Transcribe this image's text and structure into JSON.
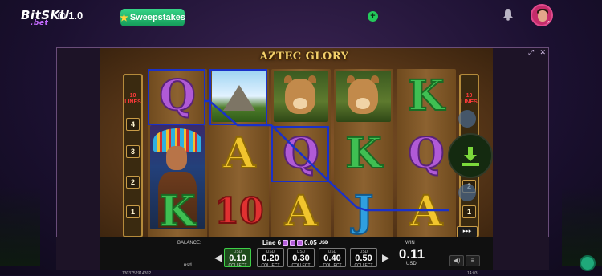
{
  "site": {
    "logo_main": "BitSKU",
    "logo_sub": ".bet",
    "version": "® 1.0",
    "sweep_label": "Sweepstakes",
    "add_label": "+",
    "avatar_chevron": "▾"
  },
  "game": {
    "title": "AZTEC GLORY",
    "lines_left": "10",
    "lines_right": "10",
    "lines_word": "LINES",
    "left_numbers": [
      "4",
      "3",
      "2",
      "1"
    ],
    "right_numbers": [
      "2",
      "1"
    ],
    "auto_label": "▸▸▸",
    "reels": [
      [
        "Q",
        "chief",
        "K"
      ],
      [
        "pyramid",
        "A",
        "10"
      ],
      [
        "puma",
        "Q",
        "A"
      ],
      [
        "puma",
        "K",
        "J"
      ],
      [
        "K",
        "Q",
        "A"
      ]
    ]
  },
  "controls": {
    "balance_label": "BALANCE:",
    "balance_unit": "usd",
    "line_label": "Line 6",
    "line_value": "0.05",
    "line_unit": "USD",
    "win_label": "WIN",
    "win_value": "0.11",
    "win_unit": "USD",
    "bets": [
      {
        "unit": "USD",
        "value": "0.10",
        "action": "COLLECT",
        "selected": true
      },
      {
        "unit": "USD",
        "value": "0.20",
        "action": "COLLECT",
        "selected": false
      },
      {
        "unit": "USD",
        "value": "0.30",
        "action": "COLLECT",
        "selected": false
      },
      {
        "unit": "USD",
        "value": "0.40",
        "action": "COLLECT",
        "selected": false
      },
      {
        "unit": "USD",
        "value": "0.50",
        "action": "COLLECT",
        "selected": false
      }
    ],
    "prev_arrow": "◀",
    "next_arrow": "▶",
    "ticket": "1303752914302",
    "clock": "14:03"
  },
  "colors": {
    "accent_green": "#24c95b",
    "payline_blue": "#1a31c9",
    "gold": "#f2cf6a"
  }
}
